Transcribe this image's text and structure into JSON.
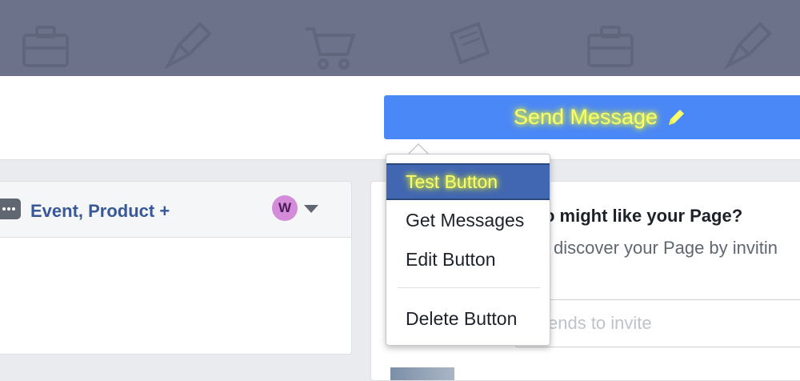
{
  "header": {
    "send_message_label": "Send Message",
    "button_color": "#4b88f7",
    "highlight_color": "#fbff6a"
  },
  "left_card": {
    "title": "Event, Product +",
    "avatar_initial": "W"
  },
  "right_card": {
    "title": "o might like your Page?",
    "subtitle": "discover your Page by invitin",
    "invite_placeholder": "ends to invite"
  },
  "dropdown": {
    "items": [
      {
        "label": "Test Button",
        "active": true
      },
      {
        "label": "Get Messages",
        "active": false
      },
      {
        "label": "Edit Button",
        "active": false
      },
      {
        "label": "Delete Button",
        "active": false
      }
    ]
  }
}
